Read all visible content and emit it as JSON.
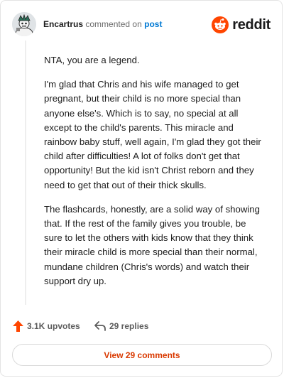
{
  "header": {
    "username": "Encartrus",
    "verb": "commented on",
    "post_link": "post",
    "brand_name": "reddit",
    "brand_color": "#ff4500"
  },
  "comment": {
    "paragraphs": [
      "NTA, you are a legend.",
      "I'm glad that Chris and his wife managed to get pregnant, but their child is no more special than anyone else's. Which is to say, no special at all except to the child's parents. This miracle and rainbow baby stuff, well again, I'm glad they got their child after difficulties! A lot of folks don't get that opportunity! But the kid isn't Christ reborn and they need to get that out of their thick skulls.",
      "The flashcards, honestly, are a solid way of showing that. If the rest of the family gives you trouble, be sure to let the others with kids know that they think their miracle child is more special than their normal, mundane children (Chris's words) and watch their support dry up."
    ]
  },
  "actions": {
    "upvotes": "3.1K upvotes",
    "replies": "29 replies",
    "upvote_color": "#ff4500"
  },
  "footer": {
    "view_comments": "View 29 comments"
  }
}
